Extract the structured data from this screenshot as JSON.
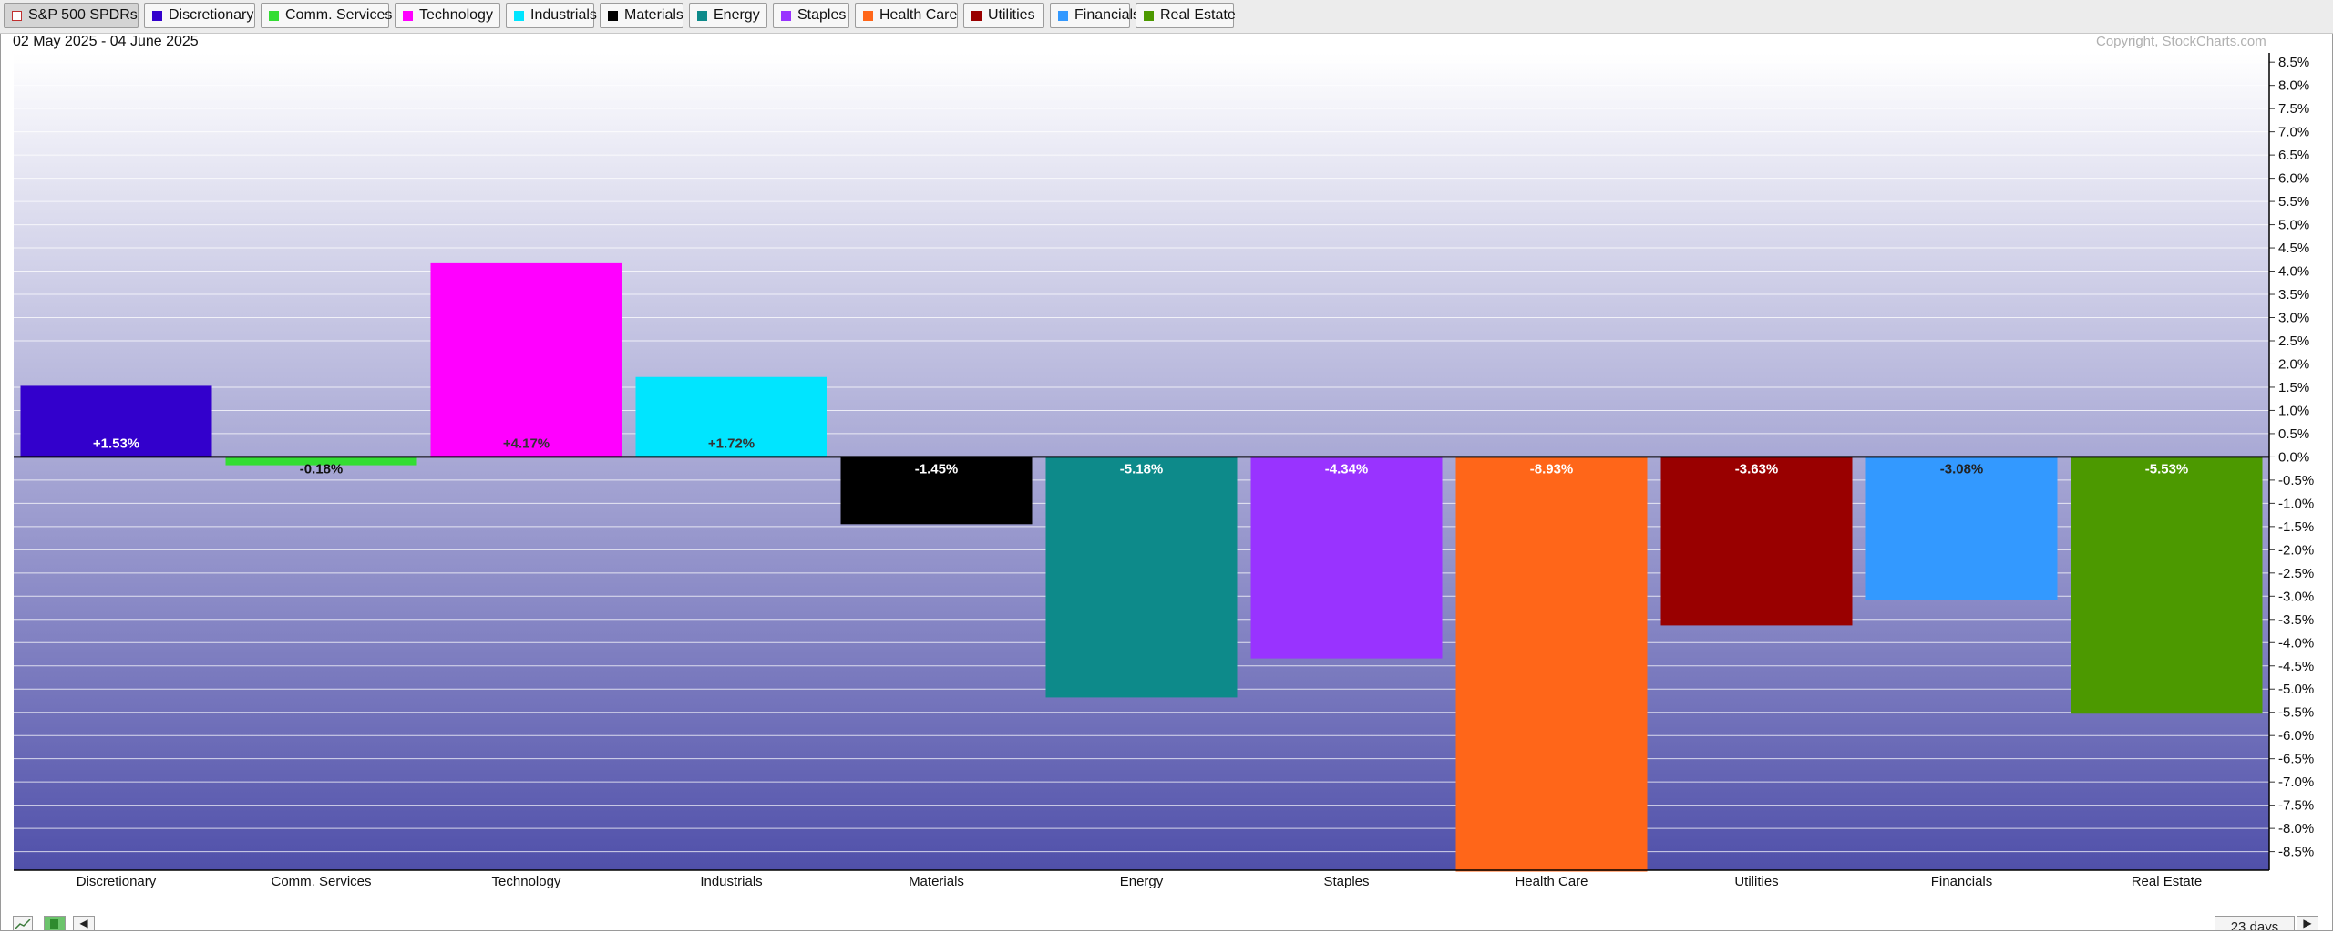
{
  "legend": {
    "items": [
      {
        "label": "S&P 500 SPDRs",
        "color": "#ffffff"
      },
      {
        "label": "Discretionary",
        "color": "#3300cc"
      },
      {
        "label": "Comm. Services",
        "color": "#33dd33"
      },
      {
        "label": "Technology",
        "color": "#ff00ff"
      },
      {
        "label": "Industrials",
        "color": "#00e5ff"
      },
      {
        "label": "Materials",
        "color": "#000000"
      },
      {
        "label": "Energy",
        "color": "#0d8a8a"
      },
      {
        "label": "Staples",
        "color": "#9933ff"
      },
      {
        "label": "Health Care",
        "color": "#ff6619"
      },
      {
        "label": "Utilities",
        "color": "#990000"
      },
      {
        "label": "Financials",
        "color": "#3399ff"
      },
      {
        "label": "Real Estate",
        "color": "#4c9900"
      }
    ]
  },
  "header": {
    "date_range": "02 May 2025 - 04 June 2025",
    "copyright": "Copyright, StockCharts.com"
  },
  "chart_data": {
    "type": "bar",
    "categories": [
      "Discretionary",
      "Comm. Services",
      "Technology",
      "Industrials",
      "Materials",
      "Energy",
      "Staples",
      "Health Care",
      "Utilities",
      "Financials",
      "Real Estate"
    ],
    "values": [
      1.53,
      -0.18,
      4.17,
      1.72,
      -1.45,
      -5.18,
      -4.34,
      -8.93,
      -3.63,
      -3.08,
      -5.53
    ],
    "value_labels": [
      "+1.53%",
      "-0.18%",
      "+4.17%",
      "+1.72%",
      "-1.45%",
      "-5.18%",
      "-4.34%",
      "-8.93%",
      "-3.63%",
      "-3.08%",
      "-5.53%"
    ],
    "colors": [
      "#3300cc",
      "#33dd33",
      "#ff00ff",
      "#00e5ff",
      "#000000",
      "#0d8a8a",
      "#9933ff",
      "#ff6619",
      "#990000",
      "#3399ff",
      "#4c9900"
    ],
    "label_colors": [
      "#ffffff",
      "#111111",
      "#333333",
      "#333333",
      "#ffffff",
      "#ffffff",
      "#ffffff",
      "#ffffff",
      "#ffffff",
      "#222222",
      "#ffffff"
    ],
    "ylim": [
      -8.9,
      8.7
    ],
    "y_ticks": [
      8.5,
      8.0,
      7.5,
      7.0,
      6.5,
      6.0,
      5.5,
      5.0,
      4.5,
      4.0,
      3.5,
      3.0,
      2.5,
      2.0,
      1.5,
      1.0,
      0.5,
      0.0,
      -0.5,
      -1.0,
      -1.5,
      -2.0,
      -2.5,
      -3.0,
      -3.5,
      -4.0,
      -4.5,
      -5.0,
      -5.5,
      -6.0,
      -6.5,
      -7.0,
      -7.5,
      -8.0,
      -8.5
    ],
    "y_tick_labels": [
      "8.5%",
      "8.0%",
      "7.5%",
      "7.0%",
      "6.5%",
      "6.0%",
      "5.5%",
      "5.0%",
      "4.5%",
      "4.0%",
      "3.5%",
      "3.0%",
      "2.5%",
      "2.0%",
      "1.5%",
      "1.0%",
      "0.5%",
      "0.0%",
      "-0.5%",
      "-1.0%",
      "-1.5%",
      "-2.0%",
      "-2.5%",
      "-3.0%",
      "-3.5%",
      "-4.0%",
      "-4.5%",
      "-5.0%",
      "-5.5%",
      "-6.0%",
      "-6.5%",
      "-7.0%",
      "-7.5%",
      "-8.0%",
      "-8.5%"
    ],
    "grid": true,
    "background_gradient": [
      "#ffffff",
      "#5050aa"
    ],
    "xlabel": "",
    "ylabel": "",
    "title": ""
  },
  "footer": {
    "period": "23 days",
    "prev_arrow": "◀",
    "next_arrow": "▶"
  }
}
